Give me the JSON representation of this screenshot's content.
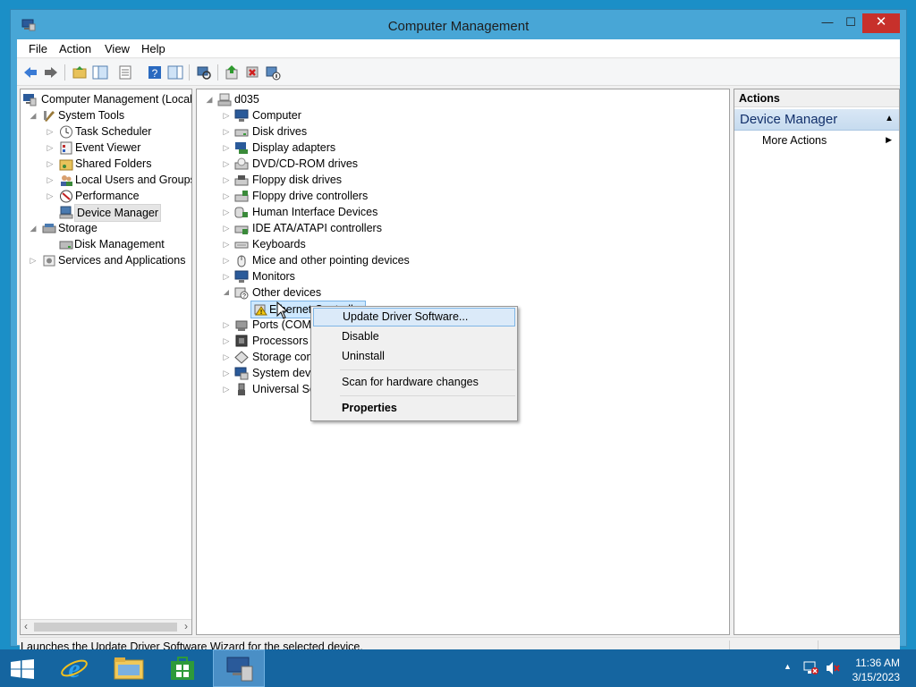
{
  "window": {
    "title": "Computer Management",
    "min_glyph": "—",
    "max_glyph": "☐",
    "close_glyph": "✕"
  },
  "menubar": [
    "File",
    "Action",
    "View",
    "Help"
  ],
  "left_tree": {
    "root": "Computer Management (Local",
    "system_tools": "System Tools",
    "task_scheduler": "Task Scheduler",
    "event_viewer": "Event Viewer",
    "shared_folders": "Shared Folders",
    "local_users": "Local Users and Groups",
    "performance": "Performance",
    "device_manager": "Device Manager",
    "storage": "Storage",
    "disk_management": "Disk Management",
    "services_apps": "Services and Applications"
  },
  "device_tree": {
    "root": "d035",
    "items": [
      "Computer",
      "Disk drives",
      "Display adapters",
      "DVD/CD-ROM drives",
      "Floppy disk drives",
      "Floppy drive controllers",
      "Human Interface Devices",
      "IDE ATA/ATAPI controllers",
      "Keyboards",
      "Mice and other pointing devices",
      "Monitors",
      "Other devices"
    ],
    "child": "Ethernet Controller",
    "items_after": [
      "Ports (COM &",
      "Processors",
      "Storage contr",
      "System devic",
      "Universal Seri"
    ]
  },
  "context_menu": {
    "update": "Update Driver Software...",
    "disable": "Disable",
    "uninstall": "Uninstall",
    "scan": "Scan for hardware changes",
    "properties": "Properties"
  },
  "actions": {
    "header": "Actions",
    "section": "Device Manager",
    "more": "More Actions"
  },
  "status_text": "Launches the Update Driver Software Wizard for the selected device.",
  "taskbar": {
    "time": "11:36 AM",
    "date": "3/15/2023"
  },
  "colors": {
    "desktop": "#1b8fc7",
    "titlebar": "#48a6d6",
    "close": "#c7302b",
    "taskbar": "#1565a0",
    "selection": "#cde8ff",
    "menu_highlight": "#dbeaf9"
  }
}
